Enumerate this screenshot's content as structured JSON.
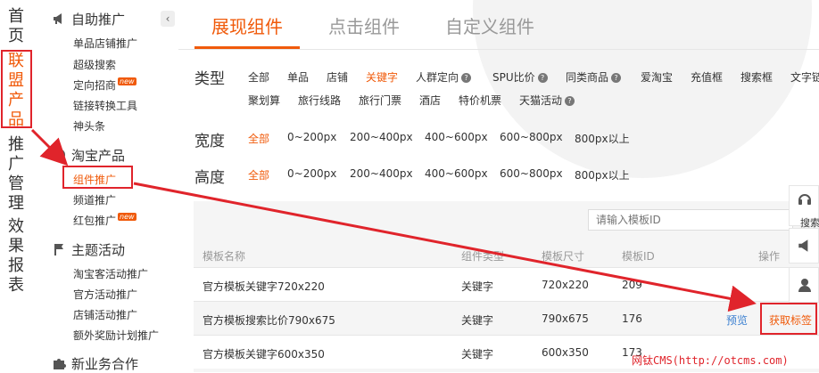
{
  "left_nav": {
    "items": [
      "首页",
      "联盟产品",
      "推广管理",
      "效果报表"
    ],
    "active_index": 1
  },
  "menu": {
    "groups": [
      {
        "title": "自助推广",
        "icon": "megaphone-icon",
        "items": [
          {
            "label": "单品店铺推广"
          },
          {
            "label": "超级搜索"
          },
          {
            "label": "定向招商",
            "badge": "new"
          },
          {
            "label": "链接转换工具"
          },
          {
            "label": "神头条"
          }
        ]
      },
      {
        "title": "淘宝产品",
        "icon": "taobao-icon",
        "items": [
          {
            "label": "组件推广",
            "active": true
          },
          {
            "label": "频道推广"
          },
          {
            "label": "红包推广",
            "badge": "new"
          }
        ]
      },
      {
        "title": "主题活动",
        "icon": "flag-icon",
        "items": [
          {
            "label": "淘宝客活动推广"
          },
          {
            "label": "官方活动推广"
          },
          {
            "label": "店铺活动推广"
          },
          {
            "label": "额外奖励计划推广"
          }
        ]
      },
      {
        "title": "新业务合作",
        "icon": "puzzle-icon",
        "items": []
      }
    ]
  },
  "tabs": [
    "展现组件",
    "点击组件",
    "自定义组件"
  ],
  "active_tab": 0,
  "filters": {
    "type_label": "类型",
    "type_options_row1": [
      "全部",
      "单品",
      "店铺",
      "关键字",
      "人群定向",
      "SPU比价",
      "同类商品",
      "爱淘宝",
      "充值框",
      "搜索框",
      "文字链"
    ],
    "type_options_row2": [
      "聚划算",
      "旅行线路",
      "旅行门票",
      "酒店",
      "特价机票",
      "天猫活动"
    ],
    "type_active": "关键字",
    "width_label": "宽度",
    "width_options": [
      "全部",
      "0~200px",
      "200~400px",
      "400~600px",
      "600~800px",
      "800px以上"
    ],
    "height_label": "高度",
    "height_options": [
      "全部",
      "0~200px",
      "200~400px",
      "400~600px",
      "600~800px",
      "800px以上"
    ]
  },
  "search": {
    "placeholder": "请输入模板ID"
  },
  "table": {
    "headers": [
      "模板名称",
      "组件类型",
      "模板尺寸",
      "模板ID",
      "操作"
    ],
    "rows": [
      {
        "name": "官方模板关键字720x220",
        "type": "关键字",
        "size": "720x220",
        "id": "209",
        "actions": []
      },
      {
        "name": "官方模板搜索比价790x675",
        "type": "关键字",
        "size": "790x675",
        "id": "176",
        "actions": [
          "预览",
          "获取标签"
        ]
      },
      {
        "name": "官方模板关键字600x350",
        "type": "关键字",
        "size": "600x350",
        "id": "173",
        "actions": []
      }
    ]
  },
  "side_tools": {
    "search_label": "搜索"
  },
  "watermark": "网钛CMS(http://otcms.com)",
  "colors": {
    "accent": "#f05a0a",
    "annotation_red": "#e0242b",
    "link": "#3a7fd0"
  }
}
